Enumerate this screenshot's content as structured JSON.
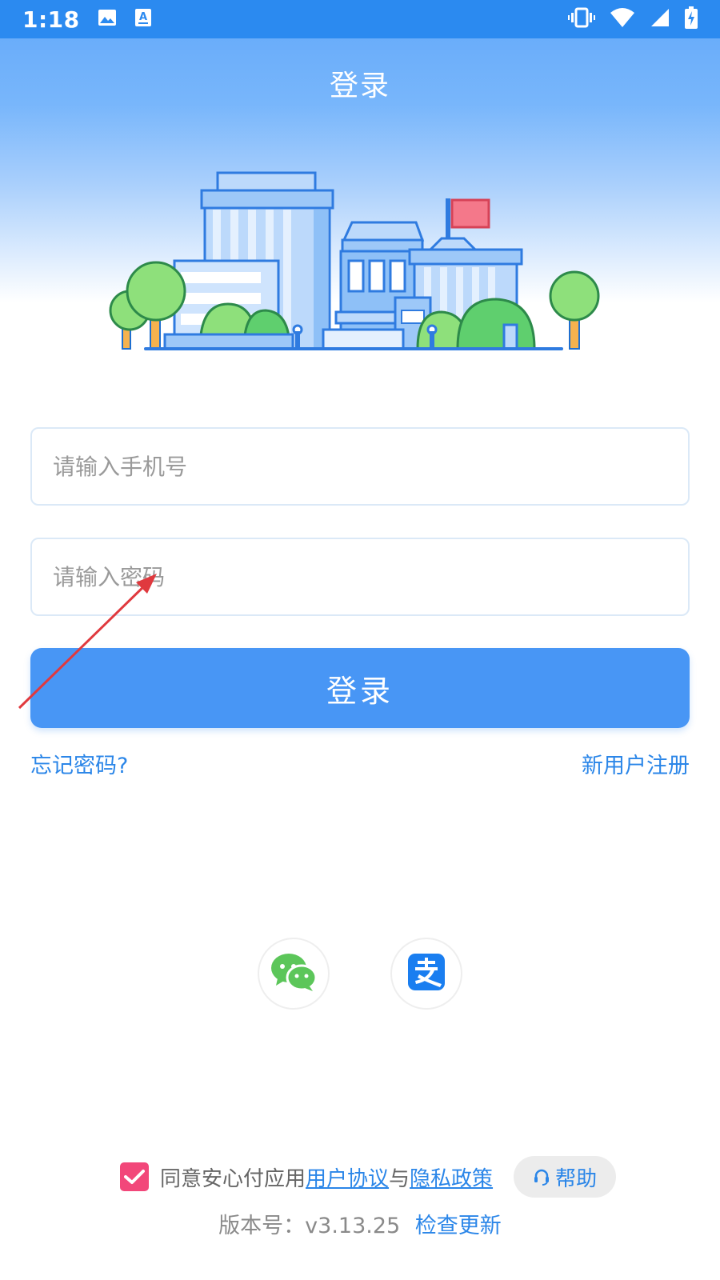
{
  "status_bar": {
    "time": "1:18",
    "icons": [
      "image-icon",
      "text-a-icon",
      "vibrate-icon",
      "wifi-icon",
      "signal-icon",
      "battery-charging-icon"
    ]
  },
  "header": {
    "title": "登录"
  },
  "form": {
    "phone_placeholder": "请输入手机号",
    "phone_value": "",
    "password_placeholder": "请输入密码",
    "password_value": "",
    "login_button": "登录"
  },
  "links": {
    "forgot_password": "忘记密码?",
    "register": "新用户注册"
  },
  "social_login": [
    {
      "name": "wechat",
      "icon": "wechat-icon"
    },
    {
      "name": "alipay",
      "icon": "alipay-icon"
    }
  ],
  "agreement": {
    "checked": true,
    "prefix": "同意安心付应用",
    "user_agreement": "用户协议",
    "conjunction": "与",
    "privacy_policy": "隐私政策",
    "help": "帮助"
  },
  "version": {
    "label": "版本号：v3.13.25",
    "check_update": "检查更新"
  },
  "colors": {
    "primary": "#4896f5",
    "link": "#2b86e8",
    "status_bar": "#2b8af0",
    "checkbox": "#f2477a",
    "annotation_arrow": "#e0393e"
  }
}
